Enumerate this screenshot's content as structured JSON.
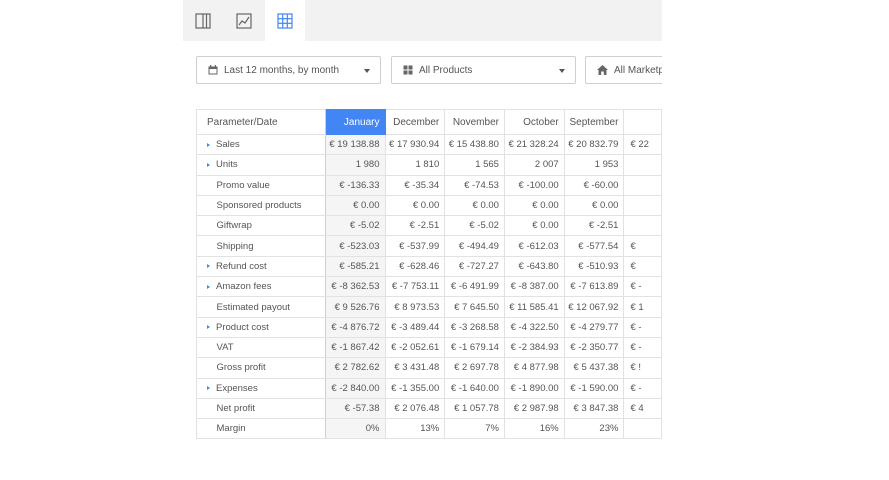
{
  "filters": {
    "date_range": "Last 12 months, by month",
    "products": "All Products",
    "marketplaces": "All Marketplaces"
  },
  "table": {
    "param_header": "Parameter/Date",
    "columns": [
      "January",
      "December",
      "November",
      "October",
      "September"
    ],
    "rows": [
      {
        "label": "Sales",
        "expandable": true,
        "values": [
          "€ 19 138.88",
          "€ 17 930.94",
          "€ 15 438.80",
          "€ 21 328.24",
          "€ 20 832.79"
        ],
        "partial": "€ 22"
      },
      {
        "label": "Units",
        "expandable": true,
        "values": [
          "1 980",
          "1 810",
          "1 565",
          "2 007",
          "1 953"
        ],
        "partial": ""
      },
      {
        "label": "Promo value",
        "expandable": false,
        "values": [
          "€ -136.33",
          "€ -35.34",
          "€ -74.53",
          "€ -100.00",
          "€ -60.00"
        ],
        "partial": ""
      },
      {
        "label": "Sponsored products",
        "expandable": false,
        "values": [
          "€ 0.00",
          "€ 0.00",
          "€ 0.00",
          "€ 0.00",
          "€ 0.00"
        ],
        "partial": ""
      },
      {
        "label": "Giftwrap",
        "expandable": false,
        "values": [
          "€ -5.02",
          "€ -2.51",
          "€ -5.02",
          "€ 0.00",
          "€ -2.51"
        ],
        "partial": ""
      },
      {
        "label": "Shipping",
        "expandable": false,
        "values": [
          "€ -523.03",
          "€ -537.99",
          "€ -494.49",
          "€ -612.03",
          "€ -577.54"
        ],
        "partial": "€"
      },
      {
        "label": "Refund cost",
        "expandable": true,
        "values": [
          "€ -585.21",
          "€ -628.46",
          "€ -727.27",
          "€ -643.80",
          "€ -510.93"
        ],
        "partial": "€"
      },
      {
        "label": "Amazon fees",
        "expandable": true,
        "values": [
          "€ -8 362.53",
          "€ -7 753.11",
          "€ -6 491.99",
          "€ -8 387.00",
          "€ -7 613.89"
        ],
        "partial": "€ -"
      },
      {
        "label": "Estimated payout",
        "expandable": false,
        "values": [
          "€ 9 526.76",
          "€ 8 973.53",
          "€ 7 645.50",
          "€ 11 585.41",
          "€ 12 067.92"
        ],
        "partial": "€ 1"
      },
      {
        "label": "Product cost",
        "expandable": true,
        "values": [
          "€ -4 876.72",
          "€ -3 489.44",
          "€ -3 268.58",
          "€ -4 322.50",
          "€ -4 279.77"
        ],
        "partial": "€ -"
      },
      {
        "label": "VAT",
        "expandable": false,
        "values": [
          "€ -1 867.42",
          "€ -2 052.61",
          "€ -1 679.14",
          "€ -2 384.93",
          "€ -2 350.77"
        ],
        "partial": "€ -"
      },
      {
        "label": "Gross profit",
        "expandable": false,
        "values": [
          "€ 2 782.62",
          "€ 3 431.48",
          "€ 2 697.78",
          "€ 4 877.98",
          "€ 5 437.38"
        ],
        "partial": "€ !"
      },
      {
        "label": "Expenses",
        "expandable": true,
        "values": [
          "€ -2 840.00",
          "€ -1 355.00",
          "€ -1 640.00",
          "€ -1 890.00",
          "€ -1 590.00"
        ],
        "partial": "€ -"
      },
      {
        "label": "Net profit",
        "expandable": false,
        "values": [
          "€ -57.38",
          "€ 2 076.48",
          "€ 1 057.78",
          "€ 2 987.98",
          "€ 3 847.38"
        ],
        "partial": "€ 4"
      },
      {
        "label": "Margin",
        "expandable": false,
        "values": [
          "0%",
          "13%",
          "7%",
          "16%",
          "23%"
        ],
        "partial": ""
      }
    ]
  }
}
